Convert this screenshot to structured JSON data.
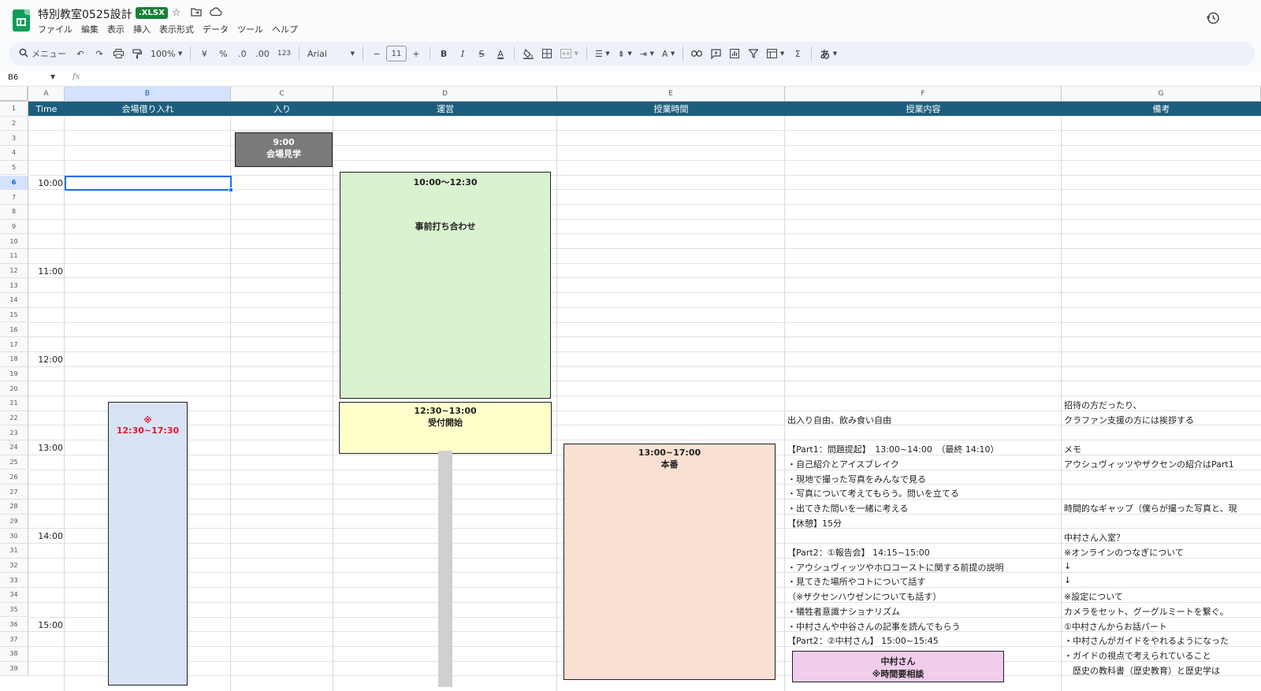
{
  "app": {
    "doc_title": "特別教室0525設計",
    "file_badge": ".XLSX",
    "menu": [
      "ファイル",
      "編集",
      "表示",
      "挿入",
      "表示形式",
      "データ",
      "ツール",
      "ヘルプ"
    ]
  },
  "toolbar": {
    "search_placeholder": "メニュー",
    "zoom": "100%",
    "currency": "¥",
    "percent": "%",
    "dec_decrease": ".0",
    "dec_increase": ".00",
    "number_format": "123",
    "font": "Arial",
    "font_size": "11",
    "minus": "−",
    "plus": "+",
    "bold": "B",
    "italic": "I",
    "strike": "S",
    "text_color": "A",
    "input_tools": "あ",
    "sum": "Σ"
  },
  "formula_bar": {
    "cell_ref": "B6",
    "fx": "fx"
  },
  "columns": [
    "A",
    "B",
    "C",
    "D",
    "E",
    "F",
    "G"
  ],
  "rows": [
    "1",
    "2",
    "3",
    "4",
    "5",
    "6",
    "7",
    "8",
    "9",
    "10",
    "11",
    "12",
    "13",
    "14",
    "15",
    "16",
    "17",
    "18",
    "19",
    "20",
    "21",
    "22",
    "23",
    "24",
    "25",
    "26",
    "27",
    "28",
    "29",
    "30",
    "31",
    "32",
    "33",
    "34",
    "35",
    "36",
    "37",
    "38",
    "39"
  ],
  "header_row": [
    "Time",
    "会場借り入れ",
    "入り",
    "運営",
    "授業時間",
    "授業内容",
    "備考"
  ],
  "times": {
    "t1000": "10:00",
    "t1100": "11:00",
    "t1200": "12:00",
    "t1300": "13:00",
    "t1400": "14:00",
    "t1500": "15:00"
  },
  "blocks": {
    "venue_tour": {
      "time": "9:00",
      "label": "会場見学",
      "color": "#7a7a7a"
    },
    "pre_meeting": {
      "time": "10:00〜12:30",
      "label": "事前打ち合わせ",
      "color": "#d9f2d0"
    },
    "reception": {
      "time": "12:30~13:00",
      "label": "受付開始",
      "color": "#ffffcc"
    },
    "main": {
      "time": "13:00~17:00",
      "label": "本番",
      "color": "#f9e0d2"
    },
    "venue_rental": {
      "mark": "※",
      "time": "12:30~17:30",
      "color": "#d8e3f5",
      "text_color": "#e0192d"
    },
    "nakamura": {
      "line1": "中村さん",
      "line2": "※時間要相談",
      "color": "#f0cdea"
    }
  },
  "content_f": [
    "出入り自由、飲み食い自由",
    "【Part1：問題提起】　13:00~14:00　（最終 14:10）",
    "・自己紹介とアイスブレイク",
    "・現地で撮った写真をみんなで見る",
    "・写真について考えてもらう。問いを立てる",
    "・出てきた問いを一緒に考える",
    "【休憩】15分",
    "【Part2：①報告会】 14:15~15:00",
    "・アウシュヴィッツやホロコーストに関する前提の説明",
    "・見てきた場所やコトについて話す",
    "（※ザクセンハウゼンについても話す）",
    "・犠牲者意識ナショナリズム",
    "・中村さんや中谷さんの記事を読んでもらう",
    "【Part2：②中村さん】 15:00~15:45"
  ],
  "notes_g": [
    "招待の方だったり、",
    "クラファン支援の方には挨拶する",
    "メモ",
    "アウシュヴィッツやザクセンの紹介はPart1",
    "時間的なギャップ（僕らが撮った写真と、現",
    "中村さん入室？",
    "※オンラインのつなぎについて",
    "↓",
    "↓",
    "※設定について",
    "カメラをセット、グーグルミートを繋ぐ。",
    "①中村さんからお話パート",
    "・中村さんがガイドをやれるようになった",
    "・ガイドの視点で考えられていること",
    "　歴史の教科書（歴史教育）と歴史学は"
  ],
  "colors": {
    "header_bg": "#1b5e7e",
    "selection": "#1a73e8"
  }
}
